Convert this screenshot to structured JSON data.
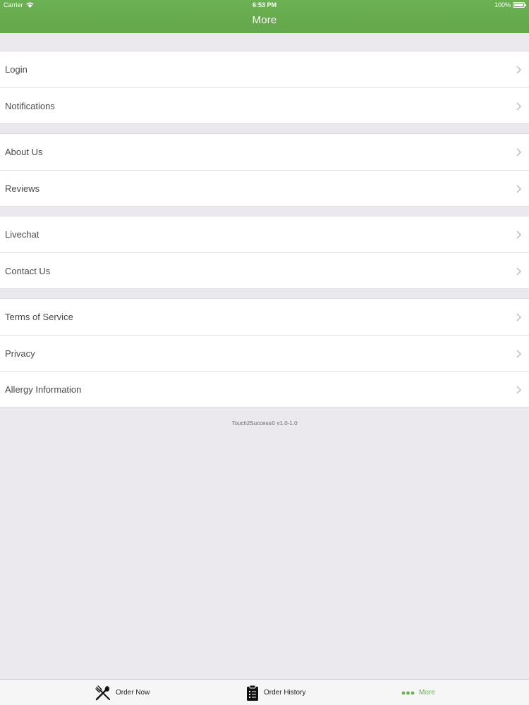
{
  "status_bar": {
    "carrier": "Carrier",
    "time": "6:53 PM",
    "battery": "100%"
  },
  "nav": {
    "title": "More"
  },
  "sections": [
    {
      "items": [
        {
          "label": "Login"
        },
        {
          "label": "Notifications"
        }
      ]
    },
    {
      "items": [
        {
          "label": "About Us"
        },
        {
          "label": "Reviews"
        }
      ]
    },
    {
      "items": [
        {
          "label": "Livechat"
        },
        {
          "label": "Contact Us"
        }
      ]
    },
    {
      "items": [
        {
          "label": "Terms of Service"
        },
        {
          "label": "Privacy"
        },
        {
          "label": "Allergy Information"
        }
      ]
    }
  ],
  "footer": {
    "version": "Touch2Success© v1.0-1.0"
  },
  "tabbar": {
    "tabs": [
      {
        "label": "Order Now",
        "icon": "fork-knife-icon",
        "active": false
      },
      {
        "label": "Order History",
        "icon": "clipboard-icon",
        "active": false
      },
      {
        "label": "More",
        "icon": "more-dots-icon",
        "active": true
      }
    ]
  },
  "colors": {
    "accent": "#6bb152",
    "background": "#ebe9ee"
  }
}
